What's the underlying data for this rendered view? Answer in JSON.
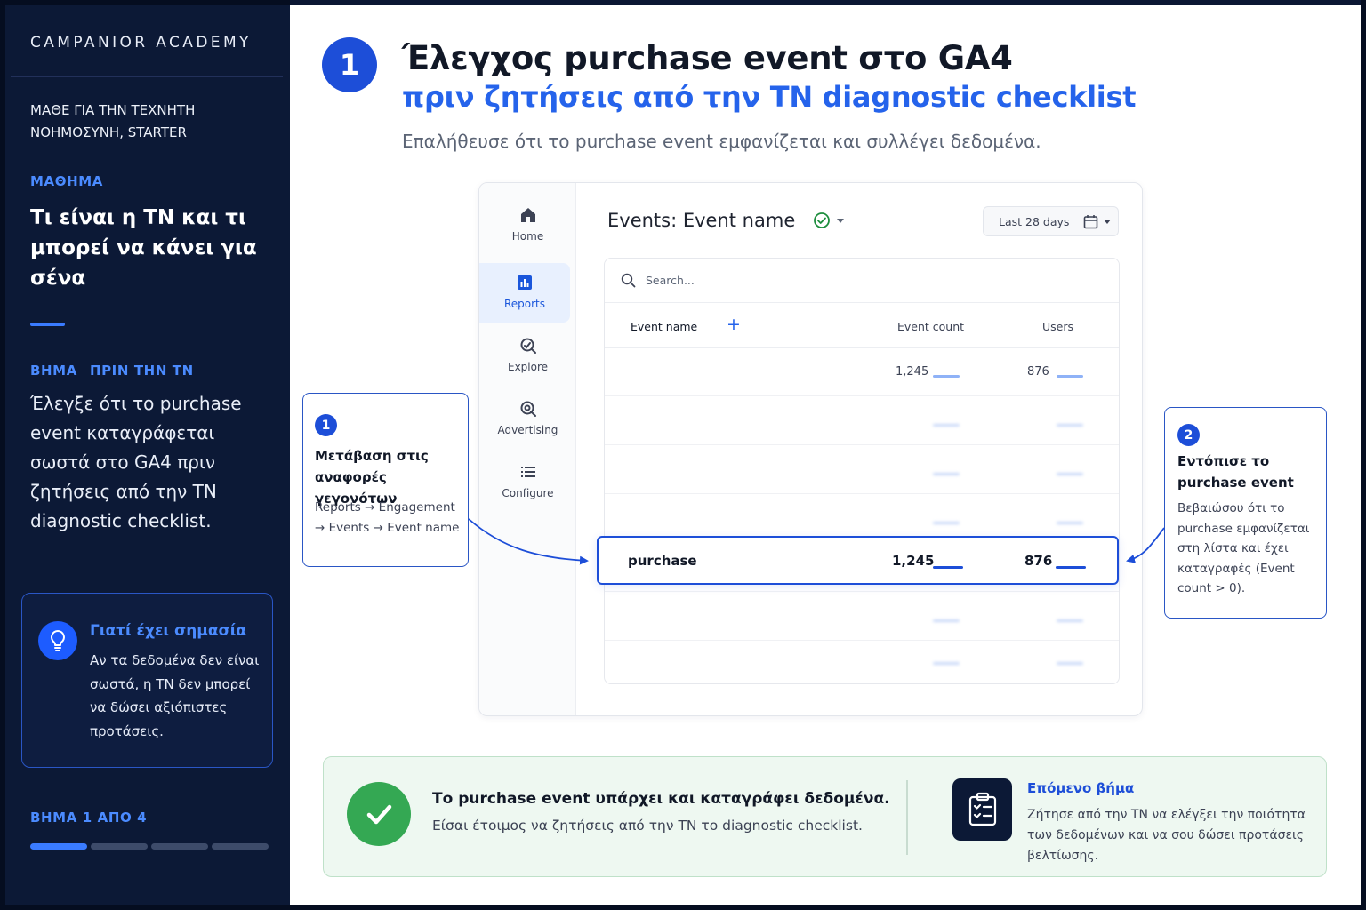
{
  "sidebar": {
    "brand": "CAMPANIOR ACADEMY",
    "course": "ΜΑΘΕ ΓΙΑ ΤΗΝ ΤΕΧΝΗΤΗ ΝΟΗΜΟΣΥΝΗ, STARTER",
    "lesson_label": "ΜΑΘΗΜΑ",
    "lesson_title": "Τι είναι η ΤΝ και τι μπορεί να κάνει για σένα",
    "step_label": "ΒΗΜΑ",
    "step_phase": "ΠΡΙΝ ΤΗΝ ΤΝ",
    "step_text": "Έλεγξε ότι το purchase event καταγράφεται σωστά στο GA4 πριν ζητήσεις από την ΤΝ diagnostic checklist.",
    "why": {
      "title": "Γιατί έχει σημασία",
      "text": "Αν τα δεδομένα δεν είναι σωστά, η ΤΝ δεν μπορεί να δώσει αξιόπιστες προτάσεις.",
      "icon": "lightbulb-icon"
    },
    "progress": {
      "label": "ΒΗΜΑ 1 ΑΠΟ 4",
      "current": 1,
      "total": 4
    }
  },
  "main": {
    "step_number": "1",
    "title": "Έλεγχος purchase event στο GA4",
    "subtitle": "πριν ζητήσεις από την ΤΝ diagnostic checklist",
    "lead": "Επαλήθευσε ότι το purchase event εμφανίζεται και συλλέγει δεδομένα."
  },
  "ga": {
    "nav": [
      {
        "label": "Home",
        "icon": "home-icon"
      },
      {
        "label": "Reports",
        "icon": "bar-chart-icon",
        "active": true
      },
      {
        "label": "Explore",
        "icon": "explore-icon"
      },
      {
        "label": "Advertising",
        "icon": "advertising-icon"
      },
      {
        "label": "Configure",
        "icon": "list-icon"
      }
    ],
    "header": "Events: Event name",
    "date_range": "Last 28 days",
    "search_placeholder": "Search...",
    "columns": {
      "name": "Event name",
      "add": "+",
      "count": "Event count",
      "users": "Users"
    },
    "rows": [
      {
        "name": "",
        "count": "1,245",
        "users": "876"
      },
      {
        "name": "",
        "count": "",
        "users": ""
      },
      {
        "name": "",
        "count": "",
        "users": ""
      },
      {
        "name": "",
        "count": "",
        "users": ""
      },
      {
        "name": "",
        "count": "",
        "users": ""
      },
      {
        "name": "",
        "count": "",
        "users": ""
      },
      {
        "name": "",
        "count": "",
        "users": ""
      }
    ],
    "highlight": {
      "name": "purchase",
      "count": "1,245",
      "users": "876"
    }
  },
  "callouts": [
    {
      "num": "1",
      "title": "Μετάβαση στις αναφορές γεγονότων",
      "text": "Reports → Engagement → Events → Event name"
    },
    {
      "num": "2",
      "title": "Εντόπισε το purchase event",
      "text": "Βεβαιώσου ότι το purchase εμφανίζεται στη λίστα και έχει καταγραφές (Event count > 0)."
    }
  ],
  "banner": {
    "title": "Το purchase event υπάρχει και καταγράφει δεδομένα.",
    "text": "Είσαι έτοιμος να ζητήσεις από την ΤΝ το diagnostic checklist.",
    "next_title": "Επόμενο βήμα",
    "next_text": "Ζήτησε από την ΤΝ να ελέγξει την ποιότητα των δεδομένων και να σου δώσει προτάσεις βελτίωσης.",
    "next_icon": "clipboard-check-icon"
  },
  "colors": {
    "sidebar_bg": "#0c1936",
    "accent": "#1d4ed8",
    "accent_light": "#4b8bff",
    "success": "#34a853"
  }
}
